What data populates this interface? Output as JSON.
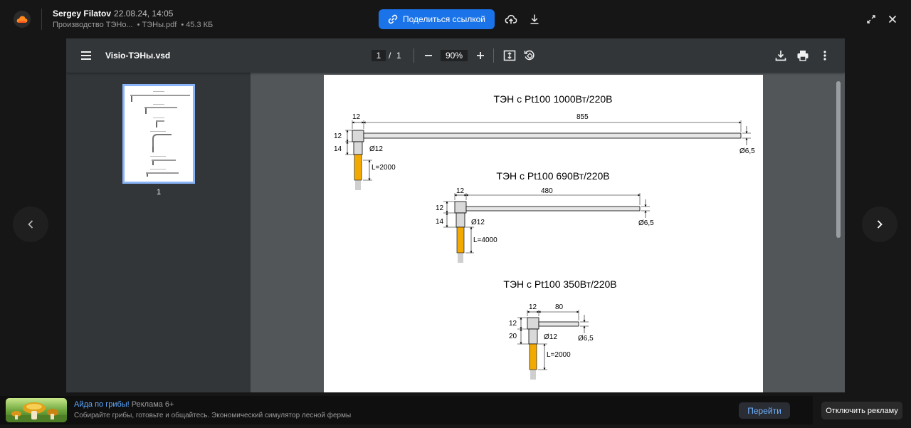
{
  "header": {
    "owner": "Sergey Filatov",
    "date": "22.08.24, 14:05",
    "folder": "Производство ТЭНо...",
    "file_name": "ТЭНы.pdf",
    "file_size": "45.3 КБ",
    "share_label": "Поделиться ссылкой"
  },
  "viewer": {
    "file_title": "Visio-ТЭНы.vsd",
    "current_page": "1",
    "page_separator": "/",
    "total_pages": "1",
    "zoom": "90%",
    "thumbnail_label": "1"
  },
  "drawing": {
    "heater1": {
      "title": "ТЭН с Pt100 1000Вт/220В",
      "dim_head": "12",
      "dim_length": "855",
      "dim_height": "12",
      "dim_neck": "14",
      "dim_dia_neck": "Ø12",
      "dim_dia_tube": "Ø6,5",
      "dim_lead": "L=2000"
    },
    "heater2": {
      "title": "ТЭН с Pt100 690Вт/220В",
      "dim_head": "12",
      "dim_length": "480",
      "dim_height": "12",
      "dim_neck": "14",
      "dim_dia_neck": "Ø12",
      "dim_dia_tube": "Ø6,5",
      "dim_lead": "L=4000"
    },
    "heater3": {
      "title": "ТЭН с Pt100 350Вт/220В",
      "dim_head": "12",
      "dim_length": "80",
      "dim_height": "12",
      "dim_neck": "20",
      "dim_dia_neck": "Ø12",
      "dim_dia_tube": "Ø6,5",
      "dim_lead": "L=2000"
    }
  },
  "ad": {
    "title": "Айда по грибы!",
    "meta": "Реклама 6+",
    "description": "Собирайте грибы, готовьте и общайтесь. Экономический симулятор лесной фермы",
    "go_label": "Перейти",
    "disable_label": "Отключить рекламу"
  },
  "colors": {
    "accent": "#1a73e8",
    "lead_wire": "#f2a900",
    "head_fill": "#d9d9d9"
  }
}
